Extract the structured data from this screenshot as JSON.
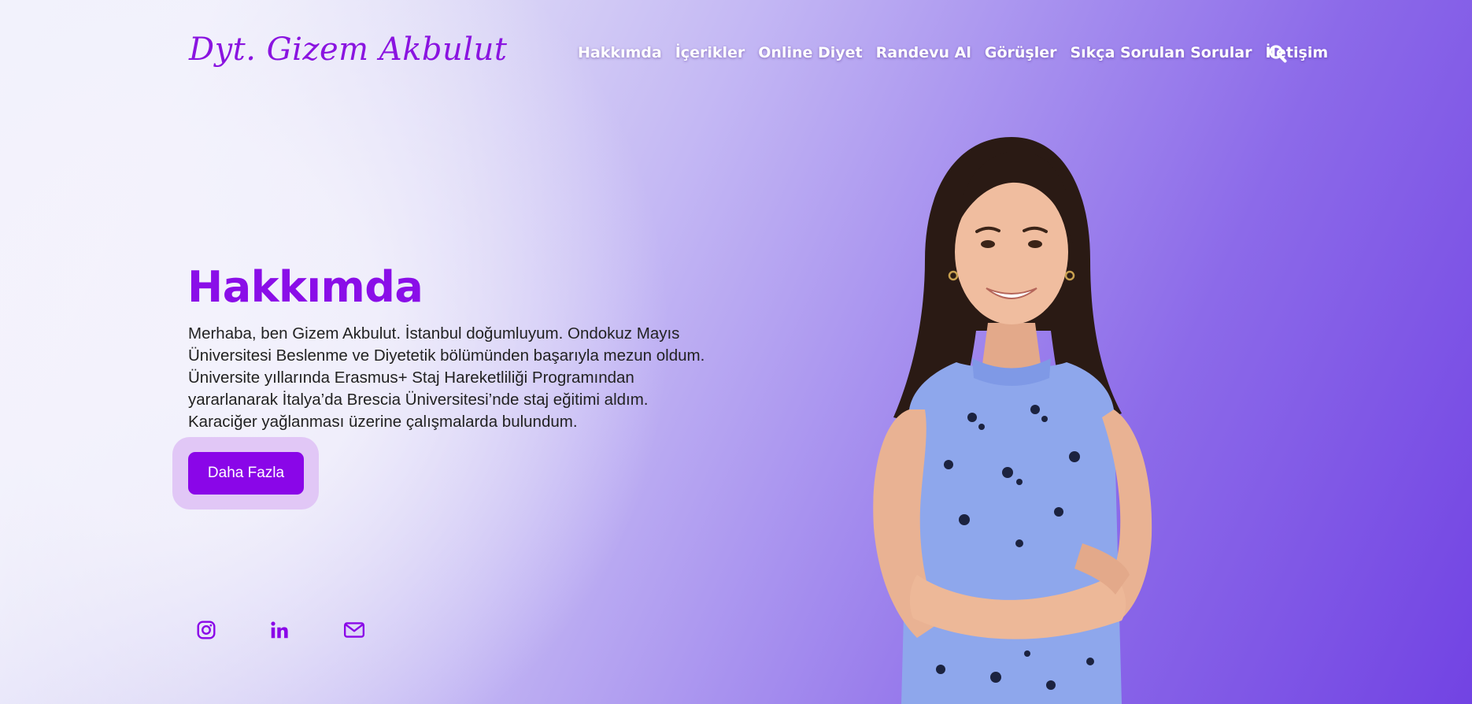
{
  "header": {
    "logo_text": "Dyt. Gizem Akbulut",
    "nav": [
      {
        "label": "Hakkımda"
      },
      {
        "label": "İçerikler"
      },
      {
        "label": "Online Diyet"
      },
      {
        "label": "Randevu Al"
      },
      {
        "label": "Görüşler"
      },
      {
        "label": "Sıkça Sorulan Sorular"
      },
      {
        "label": "İletişim"
      }
    ],
    "search_icon": "search-icon"
  },
  "hero": {
    "title": "Hakkımda",
    "text": "Merhaba, ben Gizem Akbulut. İstanbul doğumluyum. Ondokuz Mayıs Üniversitesi Beslenme ve Diyetetik bölümünden başarıyla mezun oldum. Üniversite yıllarında Erasmus+ Staj Hareketliliği Programından yararlanarak İtalya’da Brescia Üniversitesi’nde staj eğitimi aldım. Karaciğer yağlanması üzerine çalışmalarda bulundum.",
    "button_label": "Daha Fazla"
  },
  "social": [
    {
      "icon": "instagram-icon"
    },
    {
      "icon": "linkedin-icon"
    },
    {
      "icon": "mail-icon"
    }
  ],
  "colors": {
    "accent": "#8a06e8",
    "button_halo": "#e1c7f6",
    "nav_text": "#ffffff",
    "body_text": "#222222",
    "gradient_start": "#f1f1fc",
    "gradient_end": "#7243e3"
  }
}
